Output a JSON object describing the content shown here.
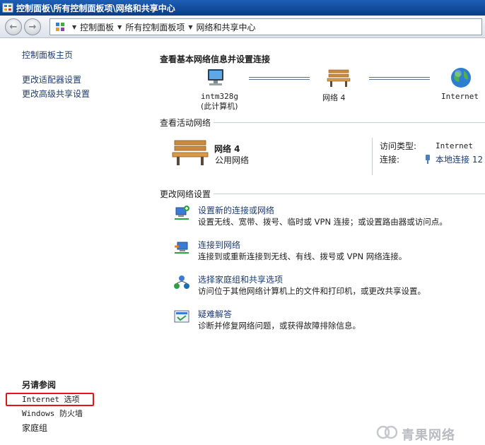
{
  "window": {
    "title": "控制面板\\所有控制面板项\\网络和共享中心"
  },
  "address_bar": {
    "crumbs": [
      "控制面板",
      "所有控制面板项",
      "网络和共享中心"
    ]
  },
  "sidebar": {
    "home": "控制面板主页",
    "links": [
      "更改适配器设置",
      "更改高级共享设置"
    ],
    "see_also_heading": "另请参阅",
    "see_also": [
      "Internet 选项",
      "Windows 防火墙",
      "家庭组"
    ]
  },
  "main": {
    "title": "查看基本网络信息并设置连接",
    "map": {
      "computer_name": "intm328g",
      "computer_sub": "(此计算机)",
      "network_name": "网络  4",
      "internet": "Internet"
    },
    "active_section": "查看活动网络",
    "active": {
      "name": "网络  4",
      "type": "公用网络",
      "access_type_label": "访问类型:",
      "access_type_value": "Internet",
      "connections_label": "连接:",
      "connections_value": "本地连接 12"
    },
    "change_section": "更改网络设置",
    "tasks": [
      {
        "title": "设置新的连接或网络",
        "desc": "设置无线、宽带、拨号、临时或 VPN 连接；或设置路由器或访问点。",
        "icon": "new-connection-icon"
      },
      {
        "title": "连接到网络",
        "desc": "连接到或重新连接到无线、有线、拨号或 VPN 网络连接。",
        "icon": "connect-network-icon"
      },
      {
        "title": "选择家庭组和共享选项",
        "desc": "访问位于其他网络计算机上的文件和打印机，或更改共享设置。",
        "icon": "homegroup-icon"
      },
      {
        "title": "疑难解答",
        "desc": "诊断并修复网络问题，或获得故障排除信息。",
        "icon": "troubleshoot-icon"
      }
    ]
  },
  "watermark": "青果网络",
  "colors": {
    "link": "#1f3c6f",
    "titlebar": "#0b3c8a",
    "highlight_box": "#e0141a"
  }
}
